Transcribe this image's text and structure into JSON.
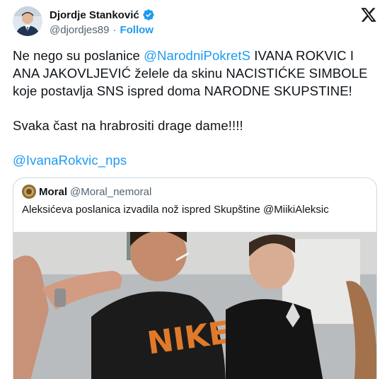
{
  "author": {
    "display_name": "Djordje Stanković",
    "handle": "@djordjes89",
    "follow_label": "Follow",
    "separator": "·"
  },
  "post": {
    "lines": [
      {
        "parts": [
          {
            "t": "Ne nego su poslanice "
          },
          {
            "t": "@NarodniPokretS",
            "mention": true
          },
          {
            "t": " IVANA ROKVIC I"
          }
        ]
      },
      {
        "parts": [
          {
            "t": "ANA JAKOVLJEVIĆ želele da skinu NACISTIĆKE SIMBOLE"
          }
        ]
      },
      {
        "parts": [
          {
            "t": "koje postavlja SNS ispred doma NARODNE SKUPSTINE!"
          }
        ]
      },
      {
        "gap": true
      },
      {
        "parts": [
          {
            "t": "Svaka čast na hrabrositi drage dame!!!!"
          }
        ]
      },
      {
        "gap": true
      },
      {
        "parts": [
          {
            "t": "@IvanaRokvic_nps",
            "mention": true
          }
        ]
      }
    ]
  },
  "quote": {
    "display_name": "Moral",
    "handle": "@Moral_nemoral",
    "text": "Aleksićeva poslanica izvadila nož ispred Skupštine @MiikiAleksic",
    "media_shirt_text": "NIKE"
  },
  "icons": {
    "verified": "verified-badge-icon",
    "platform": "x-logo-icon"
  },
  "colors": {
    "link": "#1d9bf0",
    "text": "#0f1419",
    "secondary": "#536471",
    "border": "#cfd9de"
  }
}
